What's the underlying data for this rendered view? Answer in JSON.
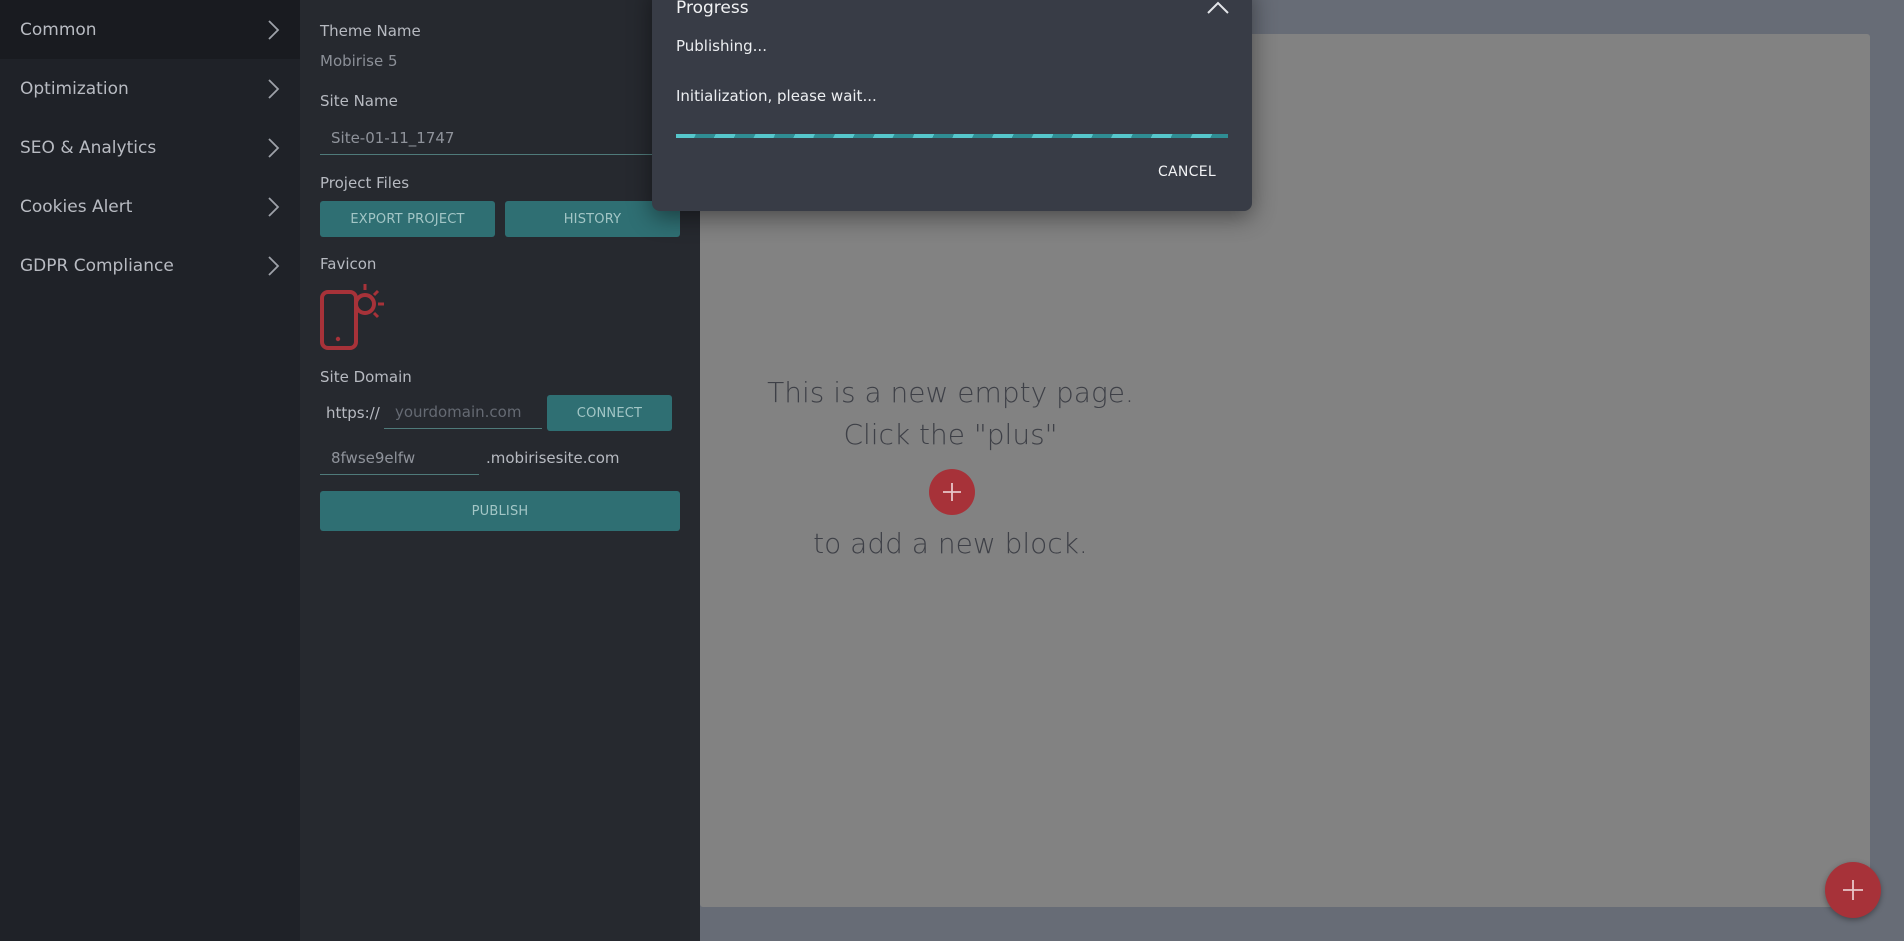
{
  "sidebar": {
    "items": [
      {
        "label": "Common"
      },
      {
        "label": "Optimization"
      },
      {
        "label": "SEO & Analytics"
      },
      {
        "label": "Cookies Alert"
      },
      {
        "label": "GDPR Compliance"
      }
    ]
  },
  "settings": {
    "theme_name_label": "Theme Name",
    "theme_name_value": "Mobirise 5",
    "site_name_label": "Site Name",
    "site_name_value": "Site-01-11_1747",
    "project_files_label": "Project Files",
    "export_button": "EXPORT PROJECT",
    "history_button": "HISTORY",
    "favicon_label": "Favicon",
    "site_domain_label": "Site Domain",
    "protocol": "https://",
    "domain_placeholder": "yourdomain.com",
    "connect_button": "CONNECT",
    "subdomain_value": "8fwse9elfw",
    "subdomain_suffix": ".mobirisesite.com",
    "publish_button": "PUBLISH"
  },
  "canvas": {
    "line1": "This is a new empty page.",
    "line2": "Click the \"plus\"",
    "line3": "to add a new block."
  },
  "dialog": {
    "title": "Progress",
    "status": "Publishing...",
    "detail": "Initialization, please wait...",
    "progress_percent": 100,
    "cancel_label": "CANCEL"
  },
  "colors": {
    "accent_teal": "#2f6f73",
    "accent_red": "#a73239"
  }
}
